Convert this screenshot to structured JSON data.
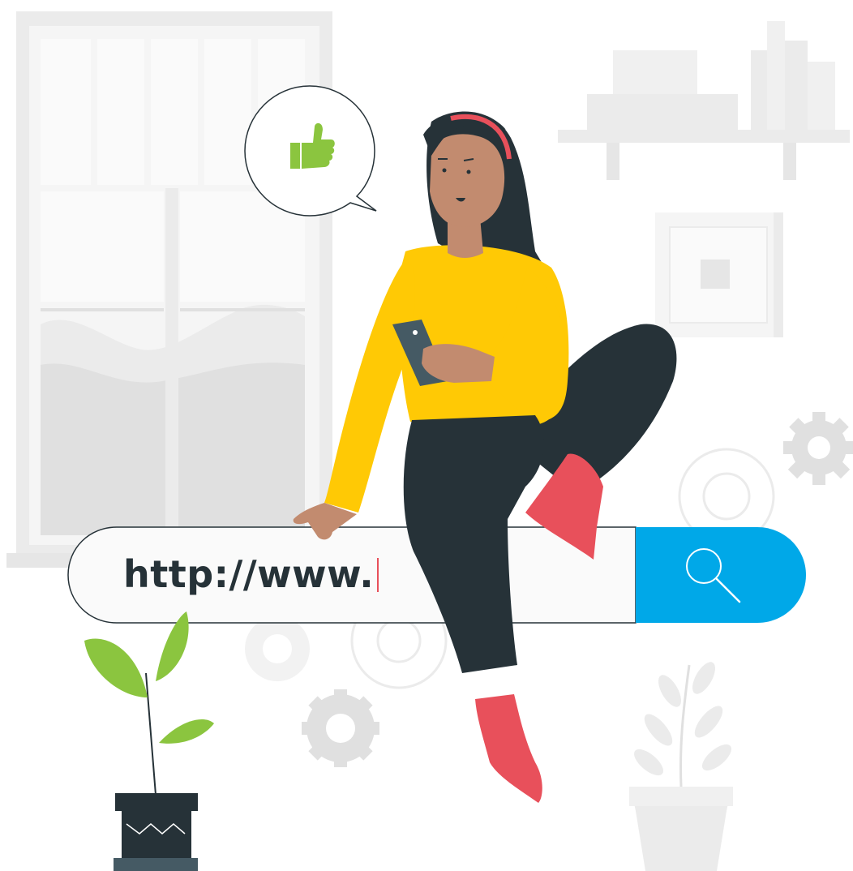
{
  "search_bar": {
    "url_value": "http://www.",
    "button_icon": "search-icon"
  },
  "speech_bubble": {
    "icon": "thumbs-up-icon"
  },
  "colors": {
    "accent_blue": "#00a8e8",
    "shirt_yellow": "#ffc905",
    "pants_dark": "#263238",
    "shoe_red": "#e8505b",
    "plant_green": "#8bc53f",
    "caret_red": "#e8505b",
    "light_gray": "#ebebeb"
  }
}
